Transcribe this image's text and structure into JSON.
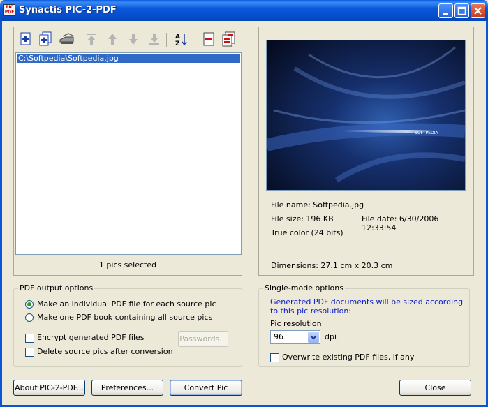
{
  "window": {
    "title": "Synactis PIC-2-PDF",
    "icon_text": "PIC PDF",
    "controls": [
      "minimize-icon",
      "maximize-icon",
      "close-icon"
    ]
  },
  "toolbar": {
    "buttons": [
      "add-file-icon",
      "add-folder-icon",
      "scanner-icon",
      "move-top-icon",
      "move-up-icon",
      "move-down-icon",
      "move-bottom-icon",
      "sort-az-icon",
      "remove-icon",
      "remove-all-icon"
    ],
    "sort_label": "AZ"
  },
  "file_list": {
    "items": [
      "C:\\Softpedia\\Softpedia.jpg"
    ],
    "selected_index": 0,
    "status": "1 pics selected"
  },
  "preview": {
    "caption": "SOFTPEDIA",
    "file_name": "File name: Softpedia.jpg",
    "file_size": "File size: 196 KB",
    "file_date": "File date: 6/30/2006 12:33:54",
    "color": "True color (24 bits)",
    "dimensions": "Dimensions: 27.1 cm x 20.3 cm"
  },
  "pdf_options": {
    "title": "PDF output options",
    "radio_individual": "Make an individual PDF file for each source pic",
    "radio_book": "Make one PDF book containing all source pics",
    "selected": "individual",
    "encrypt": "Encrypt generated PDF files",
    "delete": "Delete source pics after conversion",
    "encrypt_checked": false,
    "delete_checked": false,
    "passwords_button": "Passwords..."
  },
  "single_mode": {
    "title": "Single-mode options",
    "note": "Generated PDF documents will be sized according to this pic resolution:",
    "resolution_label": "Pic resolution",
    "resolution_value": "96",
    "unit": "dpi",
    "overwrite": "Overwrite existing PDF files, if any",
    "overwrite_checked": false
  },
  "buttons": {
    "about": "About PIC-2-PDF...",
    "preferences": "Preferences...",
    "convert": "Convert Pic",
    "close": "Close"
  },
  "colors": {
    "titlebar": "#0a58d8",
    "selection": "#316ac5",
    "face": "#ece9d8",
    "note_text": "#1020c8"
  }
}
